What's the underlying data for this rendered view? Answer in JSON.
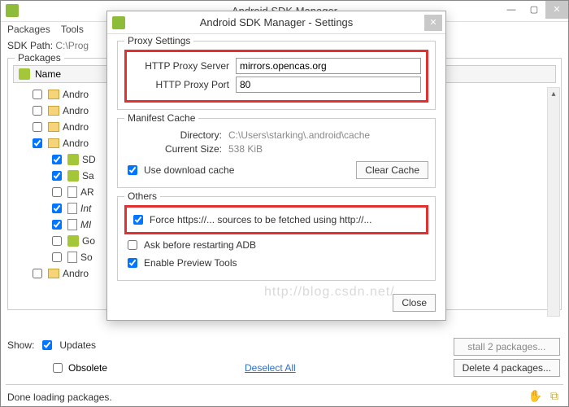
{
  "main": {
    "title": "Android SDK Manager",
    "menubar": {
      "packages": "Packages",
      "tools": "Tools"
    },
    "sdkpath_label": "SDK Path:",
    "sdkpath_value": "C:\\Prog",
    "packages_group": "Packages",
    "name_col": "Name",
    "tree": {
      "r1": "Andro",
      "r2": "Andro",
      "r3": "Andro",
      "r4": "Andro",
      "c1": "SD",
      "c2": "Sa",
      "c3": "AR",
      "c4": "Int",
      "c5": "MI",
      "c6": "Go",
      "c7": "So",
      "r5": "Andro"
    },
    "show_label": "Show:",
    "updates_label": "Updates",
    "obsolete_label": "Obsolete",
    "deselect": "Deselect All",
    "install_btn": "stall 2 packages...",
    "delete_btn": "Delete 4 packages...",
    "status": "Done loading packages."
  },
  "dialog": {
    "title": "Android SDK Manager - Settings",
    "proxy": {
      "legend": "Proxy Settings",
      "server_label": "HTTP Proxy Server",
      "server_value": "mirrors.opencas.org",
      "port_label": "HTTP Proxy Port",
      "port_value": "80"
    },
    "manifest": {
      "legend": "Manifest Cache",
      "dir_label": "Directory:",
      "dir_value": "C:\\Users\\starking\\.android\\cache",
      "size_label": "Current Size:",
      "size_value": "538 KiB",
      "use_cache": "Use download cache",
      "clear_btn": "Clear Cache"
    },
    "others": {
      "legend": "Others",
      "force_http": "Force https://... sources to be fetched using http://...",
      "ask_adb": "Ask before restarting ADB",
      "enable_preview": "Enable Preview Tools"
    },
    "close_btn": "Close"
  },
  "watermark": "http://blog.csdn.net/"
}
